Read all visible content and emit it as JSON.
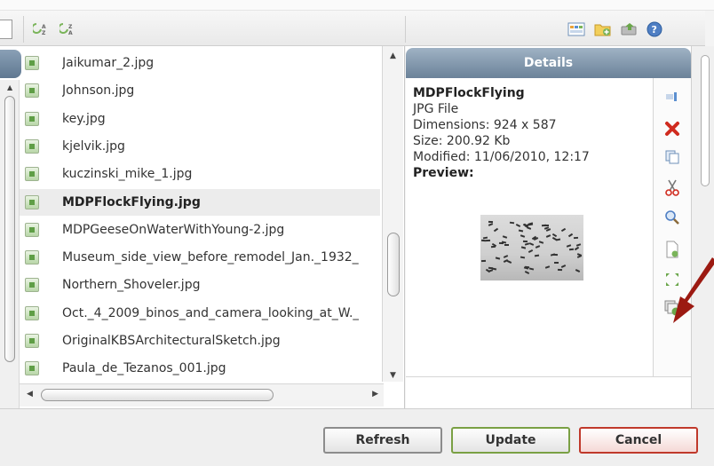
{
  "toolbar": {
    "sort_buttons": [
      "sort-az-icon",
      "sort-za-icon"
    ],
    "icons": [
      "grid-view-icon",
      "new-folder-icon",
      "upload-icon",
      "help-icon"
    ]
  },
  "files": [
    {
      "name": "Jaikumar_2.jpg",
      "selected": false
    },
    {
      "name": "Johnson.jpg",
      "selected": false
    },
    {
      "name": "key.jpg",
      "selected": false
    },
    {
      "name": "kjelvik.jpg",
      "selected": false
    },
    {
      "name": "kuczinski_mike_1.jpg",
      "selected": false
    },
    {
      "name": "MDPFlockFlying.jpg",
      "selected": true
    },
    {
      "name": "MDPGeeseOnWaterWithYoung-2.jpg",
      "selected": false
    },
    {
      "name": "Museum_side_view_before_remodel_Jan._1932_",
      "selected": false
    },
    {
      "name": "Northern_Shoveler.jpg",
      "selected": false
    },
    {
      "name": "Oct._4_2009_binos_and_camera_looking_at_W._",
      "selected": false
    },
    {
      "name": "OriginalKBSArchitecturalSketch.jpg",
      "selected": false
    },
    {
      "name": "Paula_de_Tezanos_001.jpg",
      "selected": false
    }
  ],
  "details": {
    "header": "Details",
    "file_name": "MDPFlockFlying",
    "file_type": "JPG File",
    "dimensions": "Dimensions: 924 x 587",
    "size": "Size: 200.92 Kb",
    "modified": "Modified: 11/06/2010, 12:17",
    "preview_label": "Preview:"
  },
  "actions": [
    "insert-icon",
    "delete-icon",
    "copy-icon",
    "cut-icon",
    "zoom-icon",
    "new-file-icon",
    "resize-icon",
    "duplicate-icon"
  ],
  "buttons": {
    "refresh": "Refresh",
    "update": "Update",
    "cancel": "Cancel"
  },
  "colors": {
    "header": "#7d92a8",
    "delete": "#d02b1f",
    "update_border": "#7aa044",
    "cancel_border": "#c0392b",
    "arrow": "#9c1a12"
  }
}
